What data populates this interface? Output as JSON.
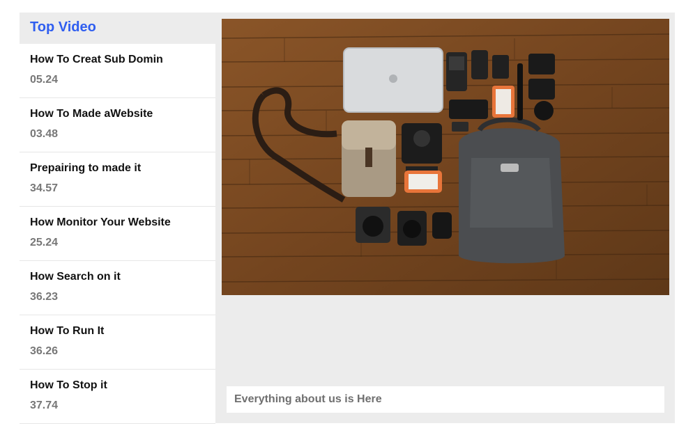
{
  "sidebar": {
    "title": "Top Video",
    "items": [
      {
        "title": "How To Creat Sub Domin",
        "duration": "05.24"
      },
      {
        "title": "How To Made aWebsite",
        "duration": "03.48"
      },
      {
        "title": "Prepairing to made it",
        "duration": "34.57"
      },
      {
        "title": "How Monitor Your Website",
        "duration": "25.24"
      },
      {
        "title": "How Search on it",
        "duration": "36.23"
      },
      {
        "title": "How To Run It",
        "duration": "36.26"
      },
      {
        "title": "How To Stop it",
        "duration": "37.74"
      }
    ]
  },
  "main": {
    "caption": "Everything about us is Here"
  },
  "colors": {
    "accent": "#2f5ef0",
    "panel_bg": "#ececec",
    "duration_text": "#777777"
  }
}
